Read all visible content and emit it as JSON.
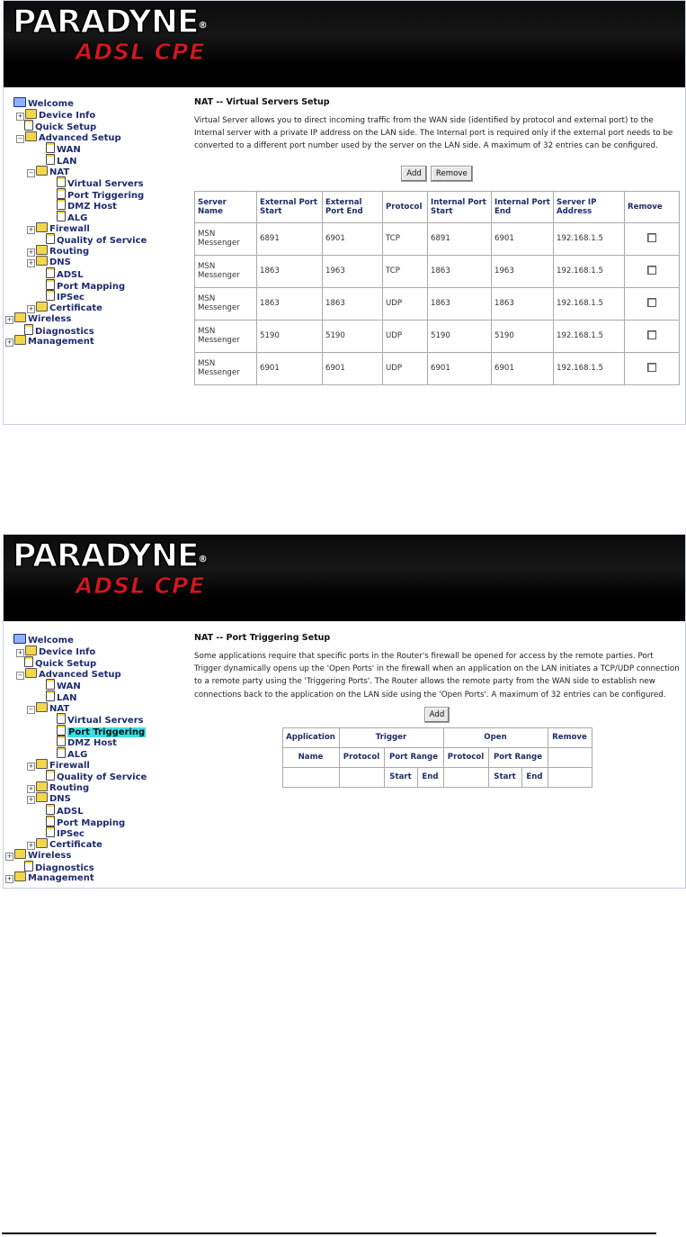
{
  "brand": {
    "name": "PARADYNE",
    "reg": "®",
    "tagline": "ADSL CPE"
  },
  "sidebar1": [
    {
      "label": "Welcome",
      "icon": "computer-icon",
      "indent": 0,
      "toggle": ""
    },
    {
      "label": "Device Info",
      "icon": "folder-icon",
      "indent": 1,
      "toggle": "+"
    },
    {
      "label": "Quick Setup",
      "icon": "page-icon",
      "indent": 1,
      "toggle": ""
    },
    {
      "label": "Advanced Setup",
      "icon": "folder-open-icon",
      "indent": 1,
      "toggle": "−"
    },
    {
      "label": "WAN",
      "icon": "page-icon",
      "indent": 3,
      "toggle": ""
    },
    {
      "label": "LAN",
      "icon": "page-icon",
      "indent": 3,
      "toggle": ""
    },
    {
      "label": "NAT",
      "icon": "folder-open-icon",
      "indent": 2,
      "toggle": "−"
    },
    {
      "label": "Virtual Servers",
      "icon": "page-icon",
      "indent": 4,
      "toggle": ""
    },
    {
      "label": "Port Triggering",
      "icon": "page-icon",
      "indent": 4,
      "toggle": ""
    },
    {
      "label": "DMZ Host",
      "icon": "page-icon",
      "indent": 4,
      "toggle": ""
    },
    {
      "label": "ALG",
      "icon": "page-icon",
      "indent": 4,
      "toggle": ""
    },
    {
      "label": "Firewall",
      "icon": "folder-icon",
      "indent": 2,
      "toggle": "+"
    },
    {
      "label": "Quality of Service",
      "icon": "page-icon",
      "indent": 3,
      "toggle": ""
    },
    {
      "label": "Routing",
      "icon": "folder-icon",
      "indent": 2,
      "toggle": "+"
    },
    {
      "label": "DNS",
      "icon": "folder-icon",
      "indent": 2,
      "toggle": "+"
    },
    {
      "label": "ADSL",
      "icon": "page-icon",
      "indent": 3,
      "toggle": ""
    },
    {
      "label": "Port Mapping",
      "icon": "page-icon",
      "indent": 3,
      "toggle": ""
    },
    {
      "label": "IPSec",
      "icon": "page-icon",
      "indent": 3,
      "toggle": ""
    },
    {
      "label": "Certificate",
      "icon": "folder-icon",
      "indent": 2,
      "toggle": "+"
    },
    {
      "label": "Wireless",
      "icon": "folder-icon",
      "indent": 0,
      "toggle": "+"
    },
    {
      "label": "Diagnostics",
      "icon": "page-icon",
      "indent": 1,
      "toggle": ""
    },
    {
      "label": "Management",
      "icon": "folder-icon",
      "indent": 0,
      "toggle": "+"
    }
  ],
  "sidebar2_selected": "Port Triggering",
  "page1": {
    "title": "NAT -- Virtual Servers Setup",
    "description": "Virtual Server allows you to direct incoming traffic from the WAN side (identified by protocol and external port) to the Internal server with a private IP address on the LAN side. The Internal port is required only if the external port needs to be converted to a different port number used by the server on the LAN side. A maximum of 32 entries can be configured.",
    "add_label": "Add",
    "remove_label": "Remove",
    "columns": [
      "Server Name",
      "External Port Start",
      "External Port End",
      "Protocol",
      "Internal Port Start",
      "Internal Port End",
      "Server IP Address",
      "Remove"
    ],
    "rows": [
      [
        "MSN Messenger",
        "6891",
        "6901",
        "TCP",
        "6891",
        "6901",
        "192.168.1.5"
      ],
      [
        "MSN Messenger",
        "1863",
        "1963",
        "TCP",
        "1863",
        "1963",
        "192.168.1.5"
      ],
      [
        "MSN Messenger",
        "1863",
        "1863",
        "UDP",
        "1863",
        "1863",
        "192.168.1.5"
      ],
      [
        "MSN Messenger",
        "5190",
        "5190",
        "UDP",
        "5190",
        "5190",
        "192.168.1.5"
      ],
      [
        "MSN Messenger",
        "6901",
        "6901",
        "UDP",
        "6901",
        "6901",
        "192.168.1.5"
      ]
    ]
  },
  "page2": {
    "title": "NAT -- Port Triggering Setup",
    "description": "Some applications require that specific ports in the Router's firewall be opened for access by the remote parties. Port Trigger dynamically opens up the 'Open Ports' in the firewall when an application on the LAN initiates a TCP/UDP connection to a remote party using the 'Triggering Ports'. The Router allows the remote party from the WAN side to establish new connections back to the application on the LAN side using the 'Open Ports'. A maximum of 32 entries can be configured.",
    "add_label": "Add",
    "headers": {
      "application": "Application",
      "trigger": "Trigger",
      "open": "Open",
      "remove": "Remove",
      "name": "Name",
      "protocol": "Protocol",
      "port_range": "Port Range",
      "start": "Start",
      "end": "End"
    }
  }
}
